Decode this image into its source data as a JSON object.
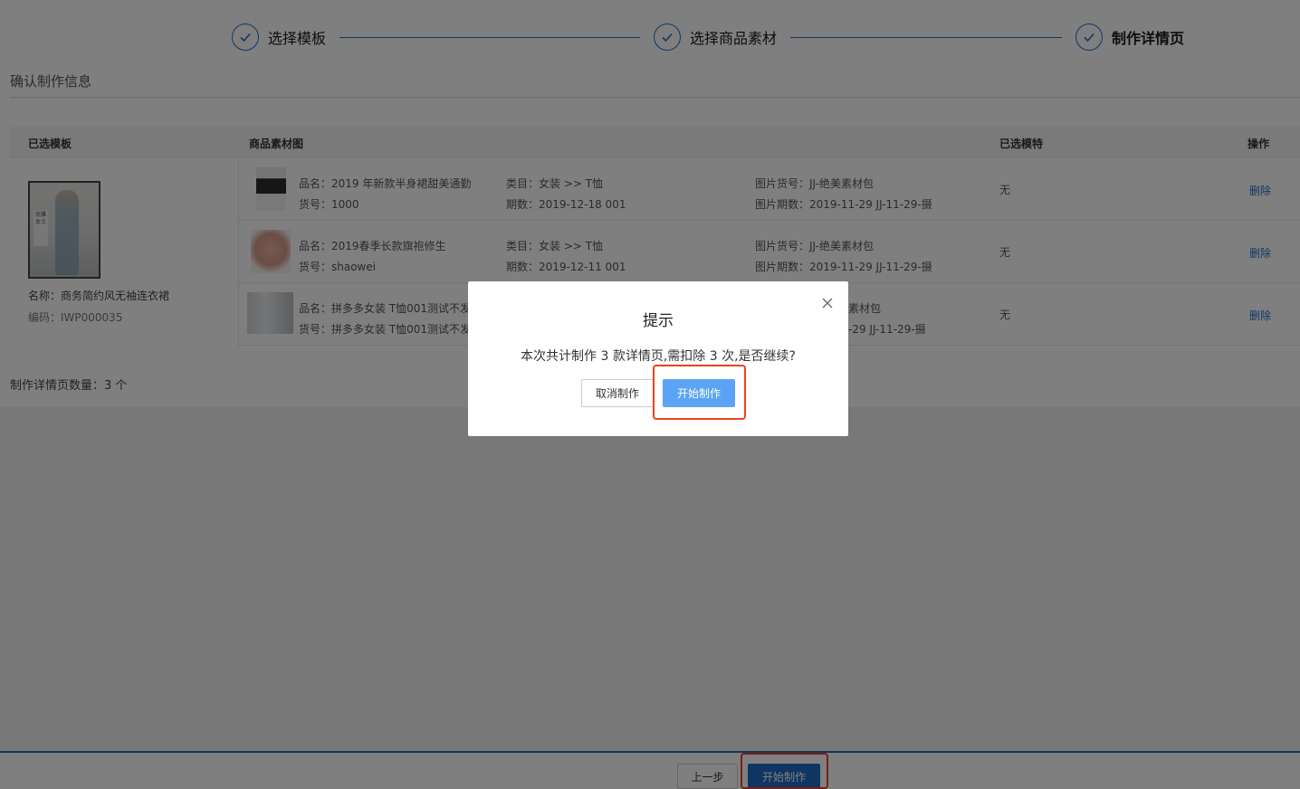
{
  "steps": [
    {
      "label": "选择模板"
    },
    {
      "label": "选择商品素材"
    },
    {
      "label": "制作详情页"
    }
  ],
  "section_title": "确认制作信息",
  "table": {
    "headers": {
      "template": "已选模板",
      "material": "商品素材图",
      "model": "已选模特",
      "action": "操作"
    },
    "template": {
      "thumb_text": "优雅女士",
      "name": "名称：商务简约风无袖连衣裙",
      "code": "编码：IWP000035"
    },
    "rows": [
      {
        "name": "品名：2019 年新款半身裙甜美通勤",
        "sku": "货号：1000",
        "category": "类目：女装 >> T恤",
        "period": "期数：2019-12-18 001",
        "img_sku": "图片货号：JJ-绝美素材包",
        "img_period": "图片期数：2019-11-29 JJ-11-29-摄",
        "model": "无",
        "action": "删除"
      },
      {
        "name": "品名：2019春季长款旗袍修生",
        "sku": "货号：shaowei",
        "category": "类目：女装 >> T恤",
        "period": "期数：2019-12-11 001",
        "img_sku": "图片货号：JJ-绝美素材包",
        "img_period": "图片期数：2019-11-29 JJ-11-29-摄",
        "model": "无",
        "action": "删除"
      },
      {
        "name": "品名：拼多多女装 T恤001测试不发",
        "sku": "货号：拼多多女装 T恤001测试不发",
        "category": "",
        "period": "",
        "img_sku": "素材包",
        "img_period": "-29 JJ-11-29-摄",
        "model": "无",
        "action": "删除"
      }
    ]
  },
  "count_text": "制作详情页数量：3 个",
  "footer": {
    "prev_label": "上一步",
    "start_label": "开始制作"
  },
  "modal": {
    "title": "提示",
    "message": "本次共计制作 3 款详情页,需扣除 3 次,是否继续?",
    "cancel_label": "取消制作",
    "confirm_label": "开始制作"
  },
  "colors": {
    "accent": "#1f6dc7",
    "highlight": "#e8461e",
    "modal_primary": "#5ba3f5"
  }
}
